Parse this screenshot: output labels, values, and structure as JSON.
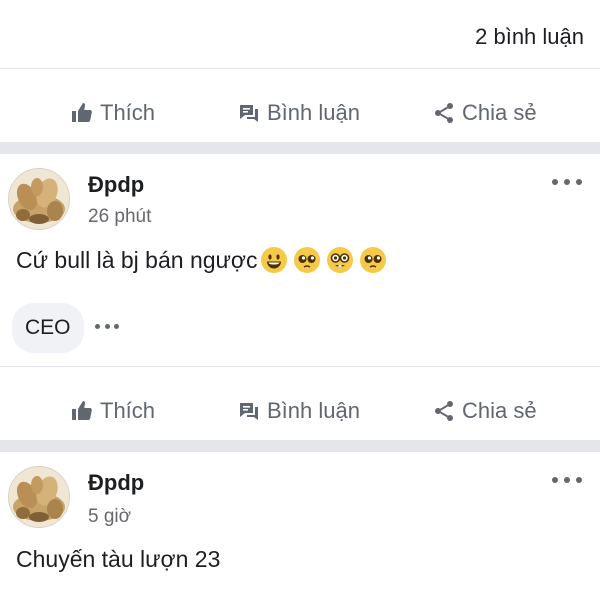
{
  "comments": {
    "count_label": "2 bình luận"
  },
  "actions": {
    "like": "Thích",
    "comment": "Bình luận",
    "share": "Chia sẻ"
  },
  "posts": [
    {
      "author": "Đpdp",
      "time": "26 phút",
      "text": "Cứ bull là bj bán ngược",
      "emojis": [
        "smiling-face-icon",
        "pleading-face-icon",
        "nerd-face-icon",
        "pleading-face-icon"
      ],
      "badge": "CEO"
    },
    {
      "author": "Đpdp",
      "time": "5 giờ",
      "text": "Chuyến tàu lượn 23"
    }
  ],
  "colors": {
    "separator": "#e4e6eb",
    "action_text": "#606770",
    "meta_text": "#65676b",
    "badge_bg": "#f0f2f5",
    "emoji_yellow": "#f7c948"
  }
}
